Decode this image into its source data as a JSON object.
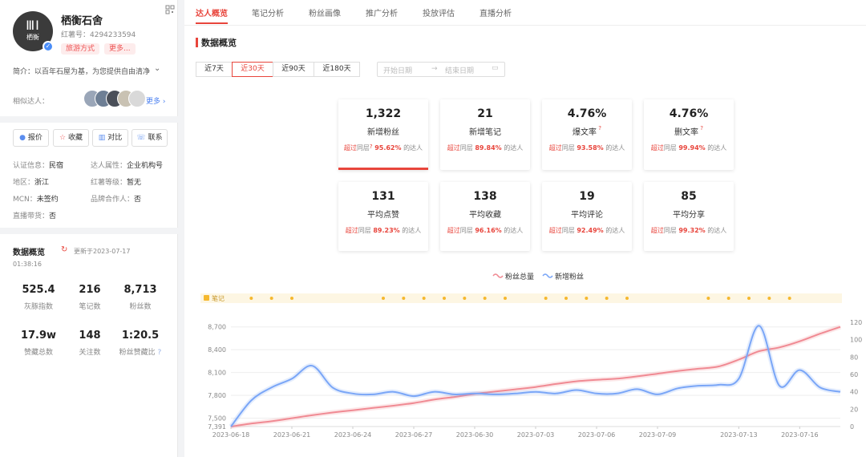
{
  "profile": {
    "name": "栖衡石舍",
    "account_id": "红薯号：4294233594",
    "avatar_text": "栖衡",
    "tags": [
      "旅游方式",
      "更多..."
    ],
    "bio": "简介：以百年石屋为基，为您提供自由清净",
    "similar_label": "相似达人：",
    "more_link": "更多",
    "corner_icon": "qr-code-icon"
  },
  "actions": [
    {
      "label": "报价",
      "icon": "price-icon"
    },
    {
      "label": "收藏",
      "icon": "star-icon"
    },
    {
      "label": "对比",
      "icon": "compare-icon"
    },
    {
      "label": "联系",
      "icon": "phone-icon"
    }
  ],
  "info": {
    "cert_label": "认证信息：",
    "cert_value": "民宿",
    "attr_label": "达人属性：",
    "attr_value": "企业机构号",
    "region_label": "地区：",
    "region_value": "浙江",
    "level_label": "红薯等级：",
    "level_value": "暂无",
    "mcn_label": "MCN：",
    "mcn_value": "未签约",
    "brand_label": "品牌合作人：",
    "brand_value": "否",
    "live_label": "直播带货：",
    "live_value": "否"
  },
  "side_overview": {
    "title": "数据概览",
    "updated": "更新于2023-07-17",
    "updated_time": "01:38:16",
    "stats": [
      {
        "value": "525.4",
        "label": "灰豚指数"
      },
      {
        "value": "216",
        "label": "笔记数"
      },
      {
        "value": "8,713",
        "label": "粉丝数"
      },
      {
        "value": "17.9w",
        "label": "赞藏总数"
      },
      {
        "value": "148",
        "label": "关注数"
      },
      {
        "value": "1:20.5",
        "label": "粉丝赞藏比"
      }
    ]
  },
  "tabs": [
    "达人概览",
    "笔记分析",
    "粉丝画像",
    "推广分析",
    "投放评估",
    "直播分析"
  ],
  "active_tab": 0,
  "section_title": "数据概览",
  "ranges": [
    "近7天",
    "近30天",
    "近90天",
    "近180天"
  ],
  "active_range": 1,
  "date": {
    "start_placeholder": "开始日期",
    "end_placeholder": "结束日期",
    "sep": "→"
  },
  "cards": [
    {
      "value": "1,322",
      "label": "新增粉丝",
      "prefix": "超过",
      "mid": "同层",
      "pct": "95.62%",
      "suffix": "的达人"
    },
    {
      "value": "21",
      "label": "新增笔记",
      "prefix": "超过",
      "mid": "同层",
      "pct": "89.84%",
      "suffix": "的达人"
    },
    {
      "value": "4.76%",
      "label": "爆文率",
      "prefix": "超过",
      "mid": "同层",
      "pct": "93.58%",
      "suffix": "的达人"
    },
    {
      "value": "4.76%",
      "label": "删文率",
      "prefix": "超过",
      "mid": "同层",
      "pct": "99.94%",
      "suffix": "的达人"
    },
    {
      "value": "131",
      "label": "平均点赞",
      "prefix": "超过",
      "mid": "同层",
      "pct": "89.23%",
      "suffix": "的达人"
    },
    {
      "value": "138",
      "label": "平均收藏",
      "prefix": "超过",
      "mid": "同层",
      "pct": "96.16%",
      "suffix": "的达人"
    },
    {
      "value": "19",
      "label": "平均评论",
      "prefix": "超过",
      "mid": "同层",
      "pct": "92.49%",
      "suffix": "的达人"
    },
    {
      "value": "85",
      "label": "平均分享",
      "prefix": "超过",
      "mid": "同层",
      "pct": "99.32%",
      "suffix": "的达人"
    }
  ],
  "colors": {
    "accent": "#e8453c",
    "total_line": "#f08a93",
    "new_line": "#7aa6f7",
    "note_dot": "#f5b82e"
  },
  "chart_data": {
    "type": "line",
    "legend": [
      "粉丝总量",
      "新增粉丝"
    ],
    "notes_label": "笔记",
    "x_ticks": [
      "2023-06-18",
      "2023-06-21",
      "2023-06-24",
      "2023-06-27",
      "2023-06-30",
      "2023-07-03",
      "2023-07-06",
      "2023-07-09",
      "2023-07-13",
      "2023-07-16"
    ],
    "y_left_ticks": [
      "7,391",
      "7,500",
      "7,800",
      "8,100",
      "8,400",
      "8,700"
    ],
    "y_right_ticks": [
      "0",
      "20",
      "40",
      "60",
      "80",
      "100",
      "120"
    ],
    "y_left_range": [
      7391,
      8760
    ],
    "y_right_range": [
      0,
      120
    ],
    "x_days": [
      0,
      30
    ],
    "series": [
      {
        "name": "粉丝总量",
        "axis": "left",
        "values": [
          7391,
          7430,
          7460,
          7500,
          7540,
          7575,
          7605,
          7635,
          7665,
          7700,
          7745,
          7780,
          7820,
          7850,
          7880,
          7910,
          7950,
          7985,
          8005,
          8020,
          8050,
          8085,
          8120,
          8150,
          8180,
          8270,
          8380,
          8430,
          8510,
          8610,
          8700
        ]
      },
      {
        "name": "新增粉丝",
        "axis": "right",
        "values": [
          0,
          30,
          45,
          55,
          70,
          45,
          38,
          37,
          40,
          35,
          40,
          37,
          38,
          37,
          38,
          40,
          38,
          42,
          38,
          38,
          43,
          37,
          44,
          47,
          48,
          55,
          116,
          47,
          65,
          45,
          40
        ]
      }
    ],
    "note_days": [
      1,
      2,
      3,
      7.5,
      8.5,
      9.5,
      10.5,
      11.5,
      12.5,
      13.5,
      15.5,
      16.5,
      17.5,
      18.5,
      19.5,
      23.5,
      24.5,
      25.5,
      26.5,
      27.5
    ]
  }
}
